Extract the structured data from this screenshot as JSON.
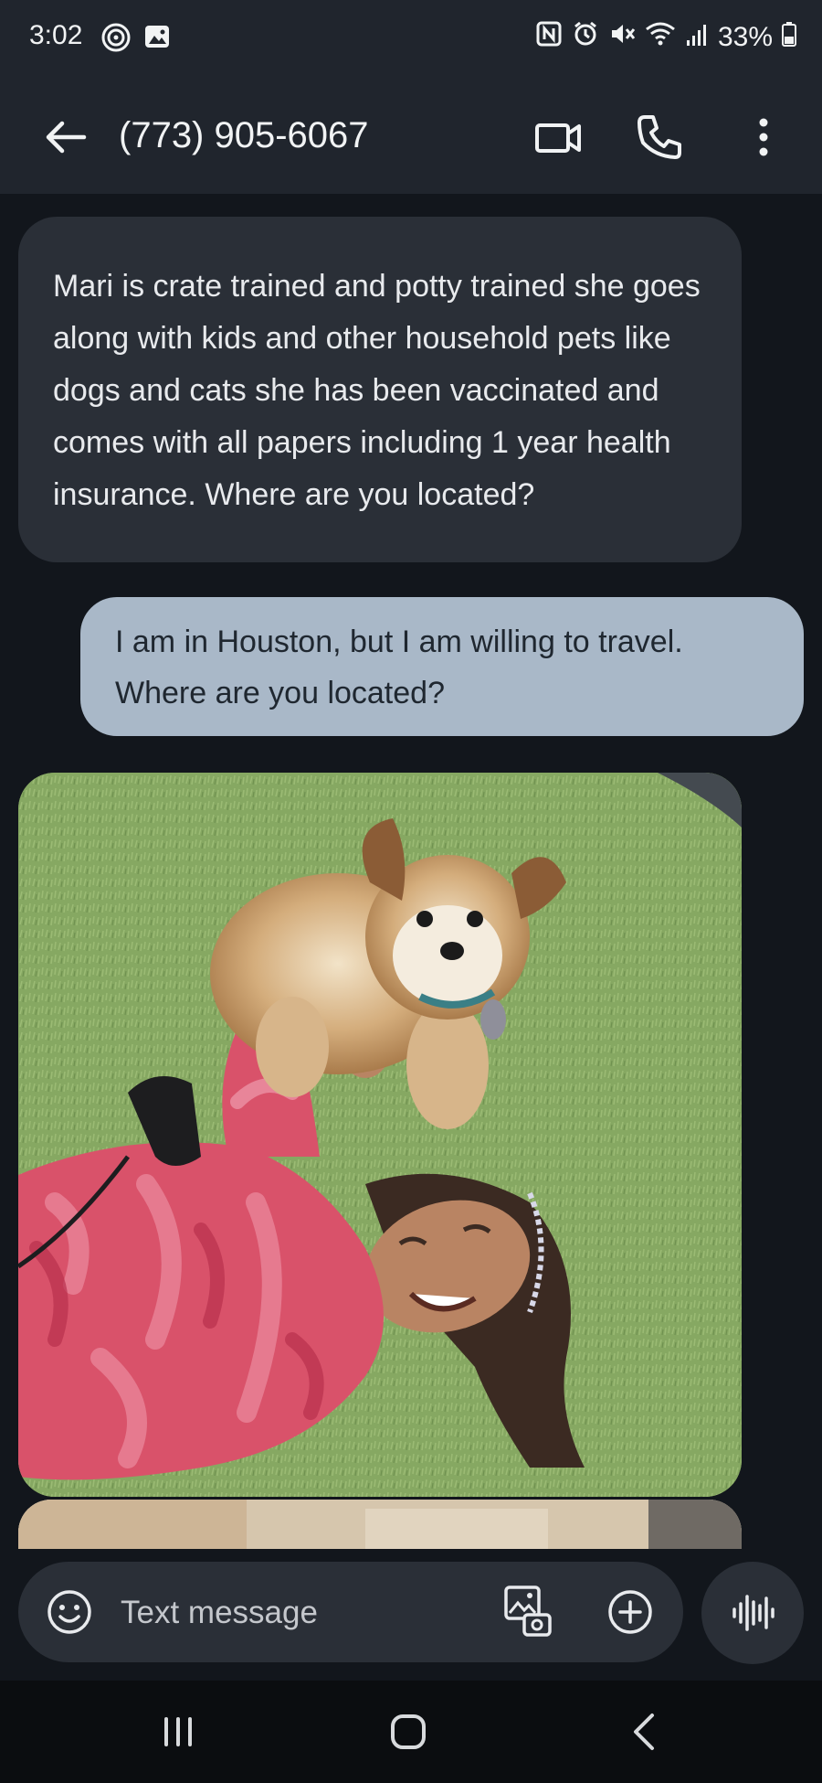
{
  "status_bar": {
    "time": "3:02",
    "battery": "33%"
  },
  "header": {
    "title": "(773) 905-6067"
  },
  "messages": [
    {
      "direction": "incoming",
      "text": "Mari is crate trained and potty trained she goes along with kids and other household pets like dogs and cats she has been vaccinated and comes with all papers including 1 year health insurance. Where are you located?"
    },
    {
      "direction": "outgoing",
      "text": "I am in Houston, but I am willing to travel. Where are you located?"
    }
  ],
  "composer": {
    "placeholder": "Text message"
  },
  "colors": {
    "background": "#12161c",
    "bar": "#20252d",
    "incoming_bubble": "#2a2f37",
    "outgoing_bubble": "#a9b8c8"
  }
}
